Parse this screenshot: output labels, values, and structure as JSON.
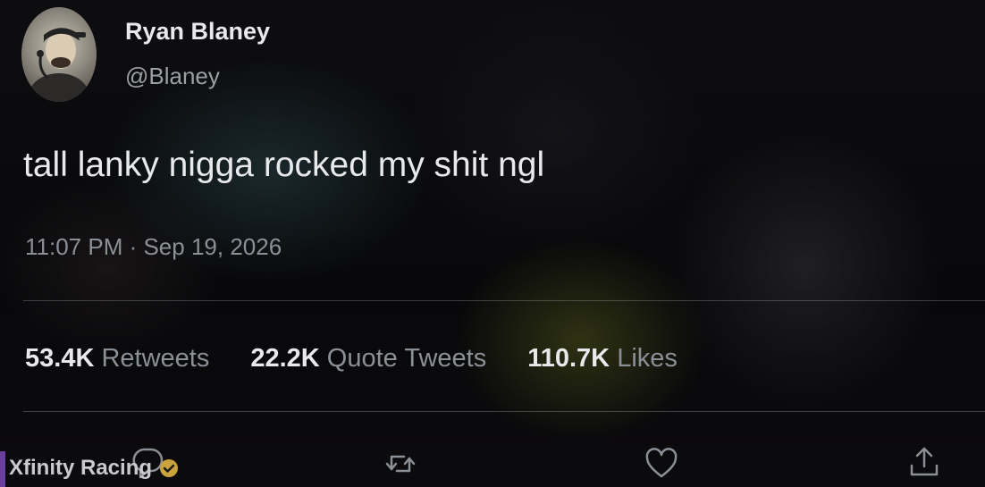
{
  "tweet": {
    "display_name": "Ryan Blaney",
    "handle": "@Blaney",
    "text": "tall lanky nigga rocked my shit ngl",
    "timestamp": "11:07 PM · Sep 19, 2026"
  },
  "stats": [
    {
      "count": "53.4K",
      "label": "Retweets"
    },
    {
      "count": "22.2K",
      "label": "Quote Tweets"
    },
    {
      "count": "110.7K",
      "label": "Likes"
    }
  ],
  "actions": {
    "reply_icon": "reply-icon",
    "retweet_icon": "retweet-icon",
    "like_icon": "heart-icon",
    "share_icon": "share-icon"
  },
  "overlay_account": {
    "name": "Xfinity Racing",
    "verified_color": "#c8a23a"
  },
  "colors": {
    "text_primary": "#e7e9ea",
    "text_secondary": "#8b9096",
    "accent_bar": "#6a3f9e"
  }
}
